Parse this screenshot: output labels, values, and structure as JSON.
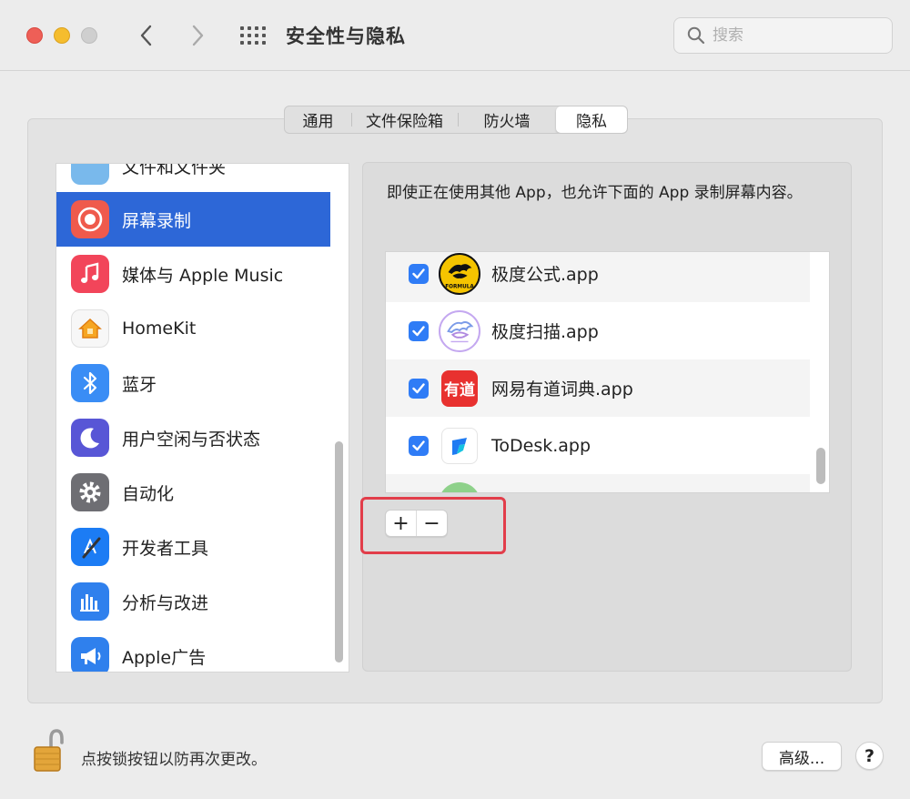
{
  "window": {
    "title": "安全性与隐私",
    "search_placeholder": "搜索"
  },
  "tabs": [
    {
      "label": "通用",
      "active": false
    },
    {
      "label": "文件保险箱",
      "active": false
    },
    {
      "label": "防火墙",
      "active": false
    },
    {
      "label": "隐私",
      "active": true
    }
  ],
  "sidebar": {
    "items": [
      {
        "label": "文件和文件夹",
        "icon": "folder-icon",
        "selected": false
      },
      {
        "label": "屏幕录制",
        "icon": "screen-recording-icon",
        "selected": true
      },
      {
        "label": "媒体与 Apple Music",
        "icon": "music-icon",
        "selected": false
      },
      {
        "label": "HomeKit",
        "icon": "homekit-icon",
        "selected": false
      },
      {
        "label": "蓝牙",
        "icon": "bluetooth-icon",
        "selected": false
      },
      {
        "label": "用户空闲与否状态",
        "icon": "moon-icon",
        "selected": false
      },
      {
        "label": "自动化",
        "icon": "gear-icon",
        "selected": false
      },
      {
        "label": "开发者工具",
        "icon": "xcode-icon",
        "selected": false
      },
      {
        "label": "分析与改进",
        "icon": "analytics-icon",
        "selected": false
      },
      {
        "label": "Apple广告",
        "icon": "megaphone-icon",
        "selected": false
      }
    ]
  },
  "privacy": {
    "description": "即使正在使用其他 App，也允许下面的 App 录制屏幕内容。",
    "apps": [
      {
        "name": "极度公式.app",
        "checked": true,
        "icon": "jidu-formula-icon",
        "icon_text": "FORMULA"
      },
      {
        "name": "极度扫描.app",
        "checked": true,
        "icon": "jidu-scan-icon"
      },
      {
        "name": "网易有道词典.app",
        "checked": true,
        "icon": "youdao-icon",
        "icon_text": "有道"
      },
      {
        "name": "ToDesk.app",
        "checked": true,
        "icon": "todesk-icon"
      }
    ],
    "add_label": "+",
    "remove_label": "−"
  },
  "footer": {
    "lock_text": "点按锁按钮以防再次更改。",
    "advanced_label": "高级...",
    "help_label": "?"
  },
  "colors": {
    "selection": "#2d67d7",
    "checkbox": "#2f7cf6",
    "highlight": "#e23d4a"
  }
}
